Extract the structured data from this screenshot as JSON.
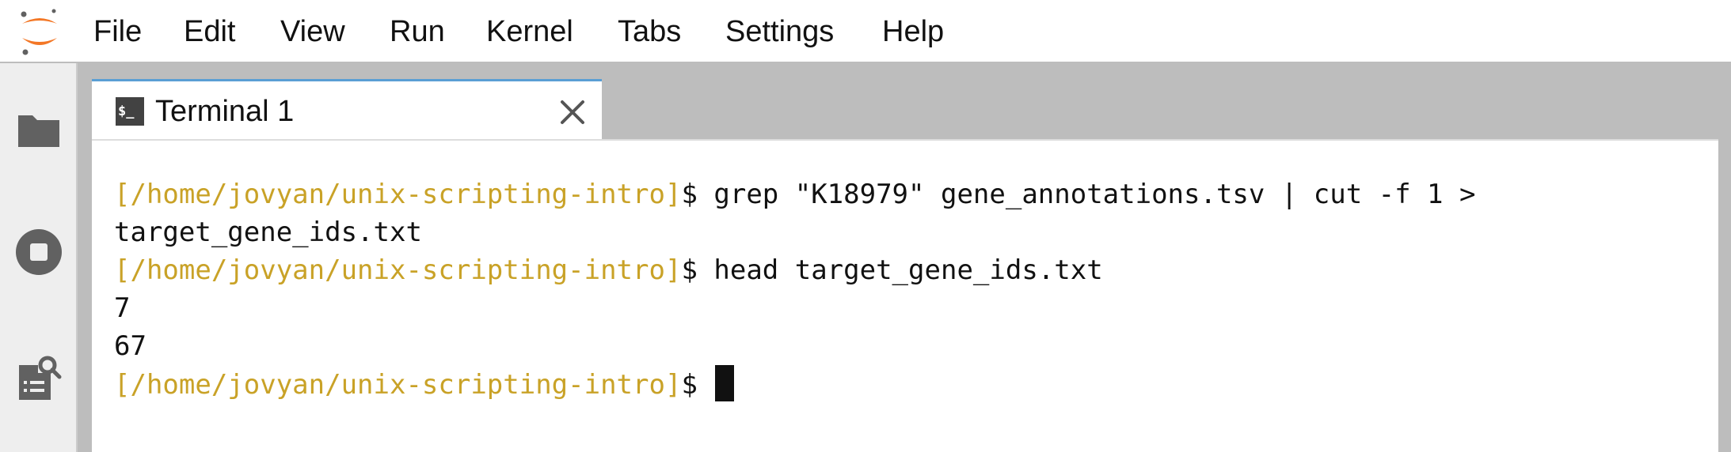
{
  "menubar": {
    "items": [
      "File",
      "Edit",
      "View",
      "Run",
      "Kernel",
      "Tabs",
      "Settings",
      "Help"
    ]
  },
  "sidebar": {
    "icons": [
      "folder-icon",
      "stop-circle-icon",
      "property-inspector-icon"
    ]
  },
  "tab": {
    "label": "Terminal 1",
    "icon_text": "$_"
  },
  "terminal": {
    "lines": [
      {
        "prompt": "[/home/jovyan/unix-scripting-intro]",
        "text": "$ grep \"K18979\" gene_annotations.tsv | cut -f 1 >"
      },
      {
        "prompt": "",
        "text": "target_gene_ids.txt"
      },
      {
        "prompt": "[/home/jovyan/unix-scripting-intro]",
        "text": "$ head target_gene_ids.txt"
      },
      {
        "prompt": "",
        "text": "7"
      },
      {
        "prompt": "",
        "text": "67"
      },
      {
        "prompt": "[/home/jovyan/unix-scripting-intro]",
        "text": "$ "
      }
    ]
  },
  "colors": {
    "prompt": "#c9a227",
    "accent": "#5a9fd4",
    "logo_orange": "#f37726"
  }
}
